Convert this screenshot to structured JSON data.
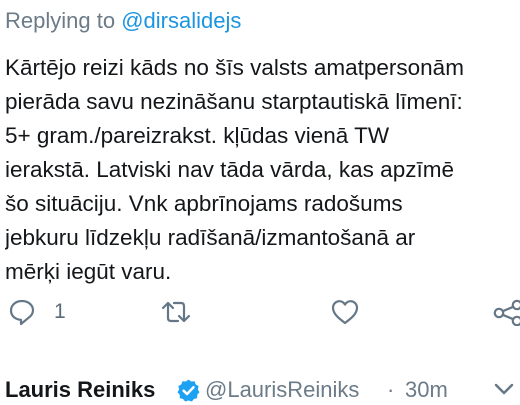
{
  "reply": {
    "prefix": "Replying to ",
    "handle": "@dirsalidejs"
  },
  "tweet": {
    "lines": [
      "Kārtējo reizi kāds no šīs valsts amatpersonām",
      "pierāda savu nezināšanu starptautiskā līmenī:",
      "5+ gram./pareizrakst. kļūdas vienā TW",
      "ierakstā. Latviski nav tāda vārda, kas apzīmē",
      "šo situāciju. Vnk apbrīnojams radošums",
      "jebkuru līdzekļu radīšanā/izmantošanā ar",
      "mērķi iegūt varu."
    ]
  },
  "actions": {
    "reply_icon": "reply-icon",
    "reply_count": "1",
    "retweet_icon": "retweet-icon",
    "like_icon": "heart-icon",
    "share_icon": "share-icon"
  },
  "next_tweet": {
    "author_name": "Lauris Reiniks",
    "verified_icon": "verified-badge-icon",
    "author_handle": "@LaurisReiniks",
    "separator": "·",
    "time": "30m",
    "menu_icon": "chevron-down-icon"
  },
  "colors": {
    "text": "#14171a",
    "muted": "#6b7b88",
    "link": "#1b95e0",
    "icon": "#657786",
    "verified": "#1da1f2"
  }
}
